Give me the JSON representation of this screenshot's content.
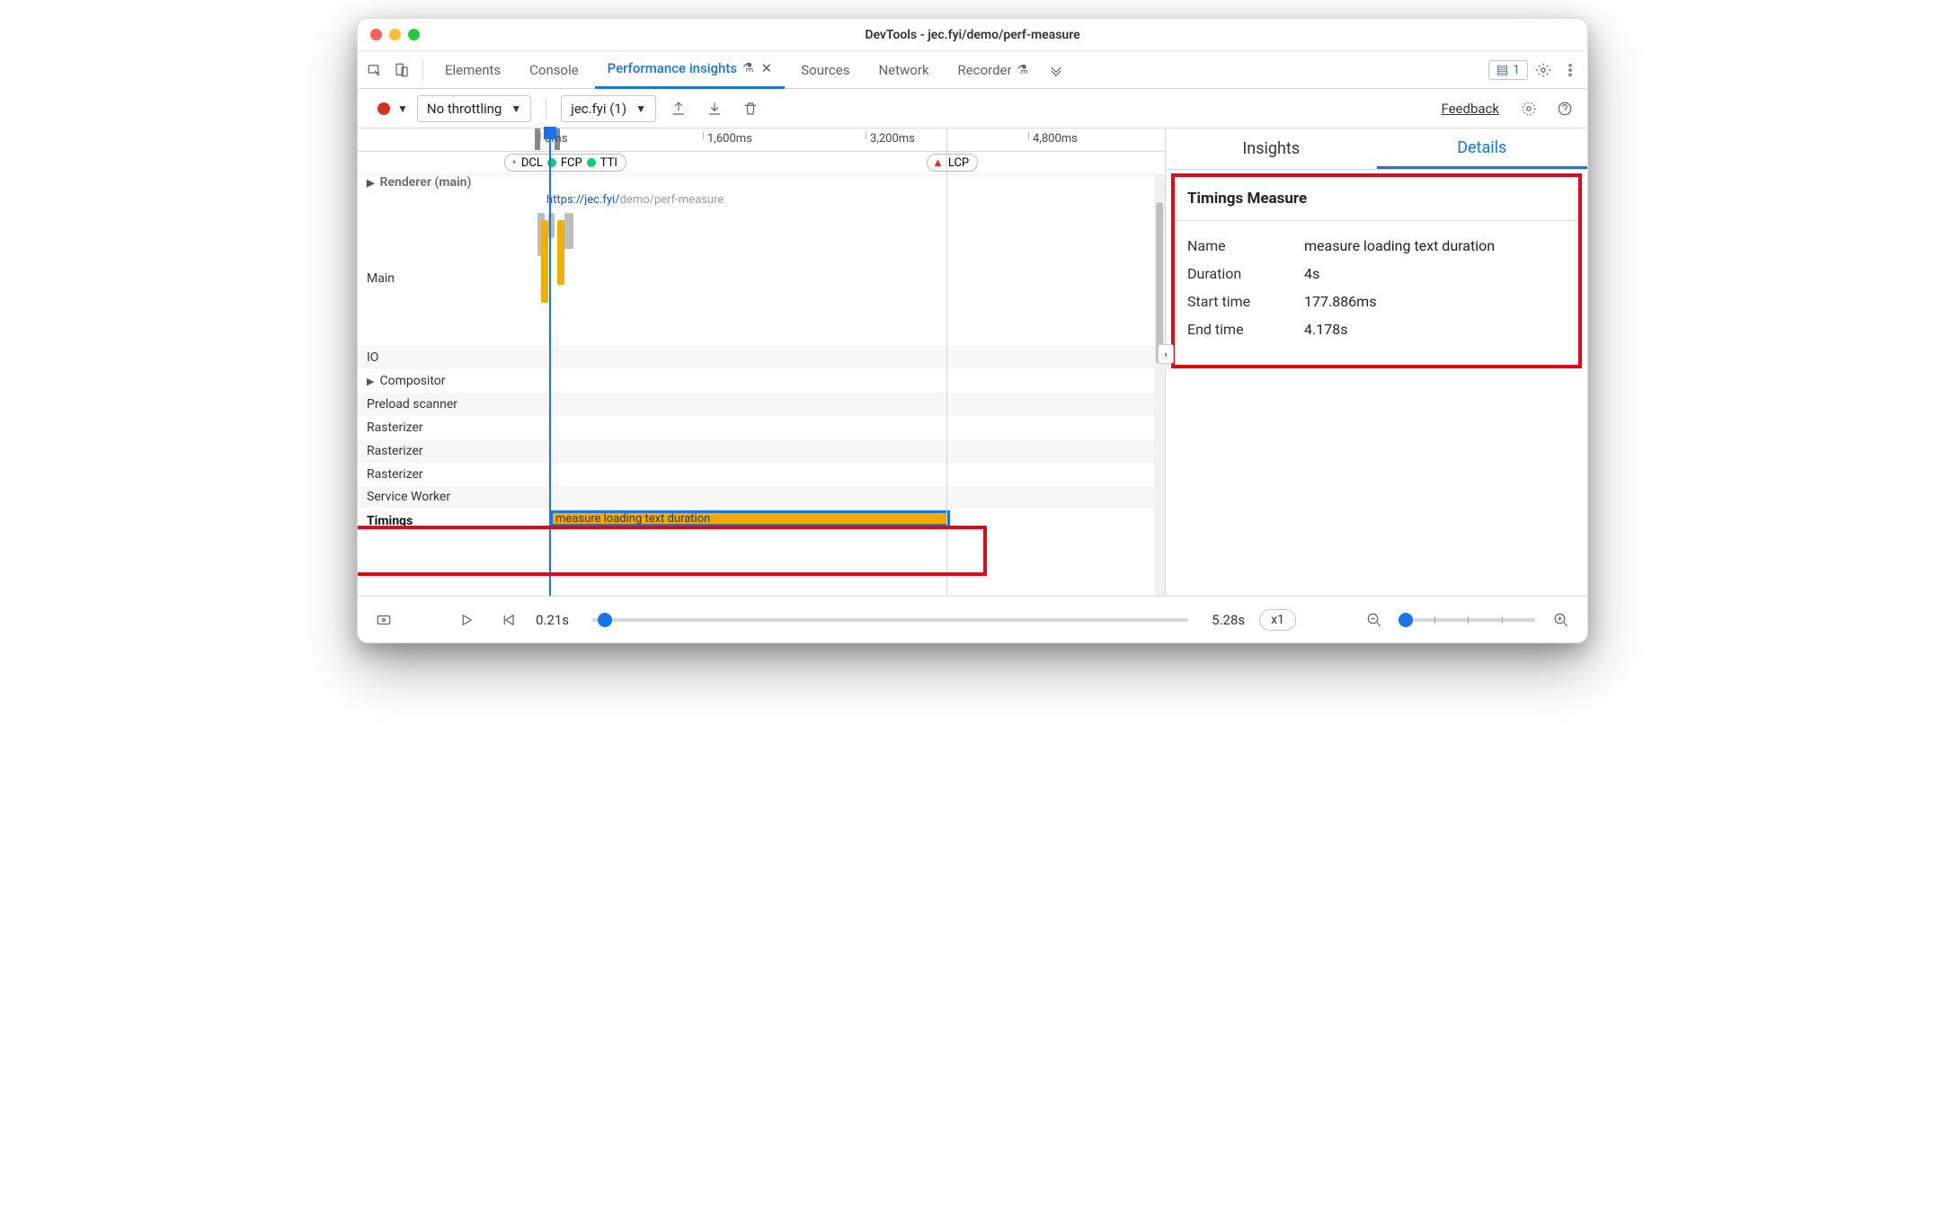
{
  "window": {
    "title": "DevTools - jec.fyi/demo/perf-measure"
  },
  "tabs": {
    "elements": "Elements",
    "console": "Console",
    "perf_insights": "Performance insights",
    "sources": "Sources",
    "network": "Network",
    "recorder": "Recorder",
    "messages_count": "1"
  },
  "toolbar": {
    "throttling": "No throttling",
    "recording_label": "jec.fyi (1)",
    "feedback": "Feedback"
  },
  "ruler": {
    "t0": "0ms",
    "t1": "1,600ms",
    "t2": "3,200ms",
    "t3": "4,800ms"
  },
  "markers": {
    "dcl": "DCL",
    "fcp": "FCP",
    "tti": "TTI",
    "lcp": "LCP"
  },
  "tracks": {
    "renderer": "Renderer (main)",
    "url_pre": "https://jec.fyi/",
    "url_suf": "demo/perf-measure",
    "main": "Main",
    "io": "IO",
    "compositor": "Compositor",
    "preload": "Preload scanner",
    "rasterizer": "Rasterizer",
    "service_worker": "Service Worker",
    "timings": "Timings",
    "measure_label": "measure loading text duration"
  },
  "right": {
    "insights_tab": "Insights",
    "details_tab": "Details",
    "section_title": "Timings Measure",
    "name_k": "Name",
    "name_v": "measure loading text duration",
    "duration_k": "Duration",
    "duration_v": "4s",
    "start_k": "Start time",
    "start_v": "177.886ms",
    "end_k": "End time",
    "end_v": "4.178s"
  },
  "footer": {
    "start": "0.21s",
    "end": "5.28s",
    "speed": "x1"
  }
}
